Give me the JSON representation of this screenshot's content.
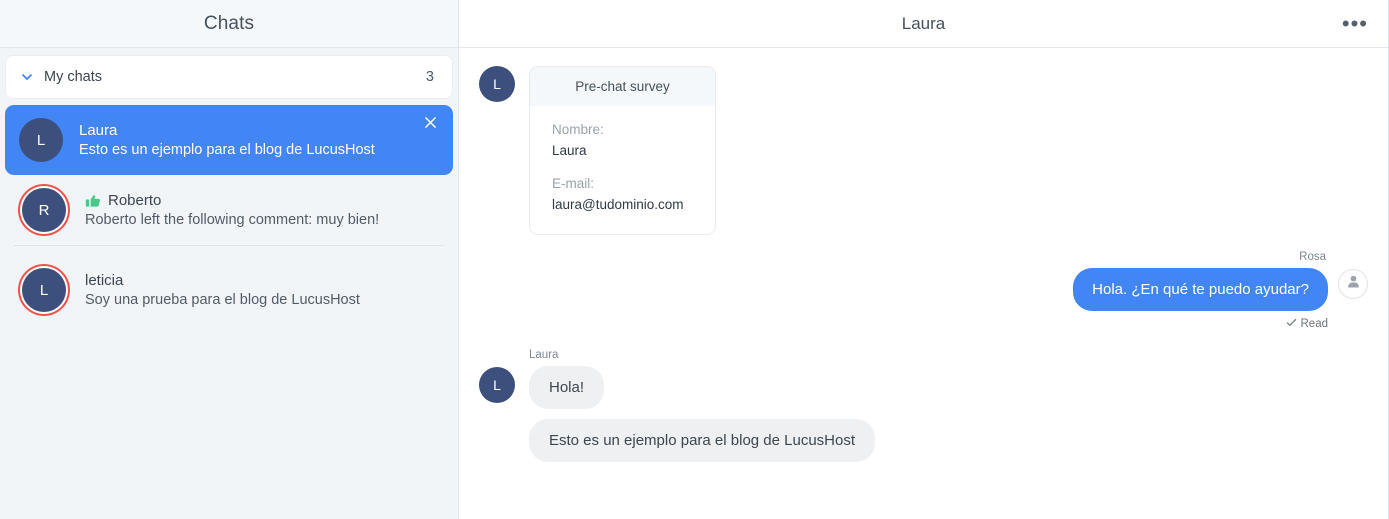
{
  "sidebar": {
    "title": "Chats",
    "group": {
      "label": "My chats",
      "count": "3",
      "chevron_icon": "chevron-down-icon"
    },
    "chats": [
      {
        "avatar_initial": "L",
        "name": "Laura",
        "preview": "Esto es un ejemplo para el blog de LucusHost",
        "selected": true,
        "has_ring": false,
        "badge_icon": "",
        "close_icon": "close-icon"
      },
      {
        "avatar_initial": "R",
        "name": "Roberto",
        "preview": "Roberto left the following comment: muy bien!",
        "selected": false,
        "has_ring": true,
        "badge_icon": "thumbs-up-icon"
      },
      {
        "avatar_initial": "L",
        "name": "leticia",
        "preview": "Soy una prueba para el blog de LucusHost",
        "selected": false,
        "has_ring": true,
        "badge_icon": ""
      }
    ]
  },
  "main": {
    "title": "Laura",
    "menu_icon": "more-options-icon",
    "survey": {
      "avatar_initial": "L",
      "header": "Pre-chat survey",
      "fields": [
        {
          "label": "Nombre:",
          "value": "Laura"
        },
        {
          "label": "E-mail:",
          "value": "laura@tudominio.com"
        }
      ]
    },
    "outgoing": {
      "sender": "Rosa",
      "text": "Hola. ¿En qué te puedo ayudar?",
      "status": "Read",
      "status_icon": "check-icon",
      "avatar_icon": "person-icon"
    },
    "incoming": {
      "sender": "Laura",
      "avatar_initial": "L",
      "messages": [
        "Hola!",
        "Esto es un ejemplo para el blog de LucusHost"
      ]
    }
  },
  "colors": {
    "accent_blue": "#4285f4",
    "avatar_navy": "#3d4f7c",
    "ring_red": "#f1524a",
    "thumb_green": "#47c98a",
    "sidebar_bg": "#f2f5f8",
    "bubble_in_bg": "#eff0f2"
  }
}
